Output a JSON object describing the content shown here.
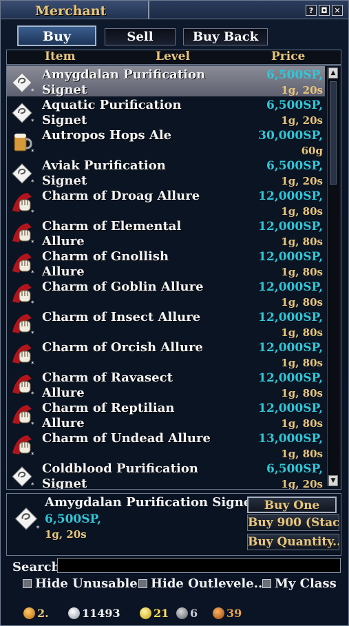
{
  "window": {
    "title": "Merchant"
  },
  "title_buttons": [
    "?",
    "◘",
    "✕"
  ],
  "tabs": [
    {
      "label": "Buy",
      "active": true
    },
    {
      "label": "Sell",
      "active": false
    },
    {
      "label": "Buy Back",
      "active": false
    }
  ],
  "columns": {
    "item": "Item",
    "level": "Level",
    "price": "Price"
  },
  "items": [
    {
      "name": "Amygdalan Purification Signet",
      "price": "6,500SP,",
      "sub": "1g, 20s",
      "icon": "signet-icon",
      "selected": true
    },
    {
      "name": "Aquatic Purification Signet",
      "price": "6,500SP,",
      "sub": "1g, 20s",
      "icon": "signet-icon"
    },
    {
      "name": "Autropos Hops Ale",
      "price": "30,000SP,",
      "sub": "60g",
      "icon": "ale-mug-icon"
    },
    {
      "name": "Aviak Purification Signet",
      "price": "6,500SP,",
      "sub": "1g, 20s",
      "icon": "signet-icon"
    },
    {
      "name": "Charm of Droag Allure",
      "price": "12,000SP,",
      "sub": "1g, 80s",
      "icon": "charm-fist-icon"
    },
    {
      "name": "Charm of Elemental Allure",
      "price": "12,000SP,",
      "sub": "1g, 80s",
      "icon": "charm-fist-icon"
    },
    {
      "name": "Charm of Gnollish Allure",
      "price": "12,000SP,",
      "sub": "1g, 80s",
      "icon": "charm-fist-icon"
    },
    {
      "name": "Charm of Goblin Allure",
      "price": "12,000SP,",
      "sub": "1g, 80s",
      "icon": "charm-fist-icon"
    },
    {
      "name": "Charm of Insect Allure",
      "price": "12,000SP,",
      "sub": "1g, 80s",
      "icon": "charm-fist-icon"
    },
    {
      "name": "Charm of Orcish Allure",
      "price": "12,000SP,",
      "sub": "1g, 80s",
      "icon": "charm-fist-icon"
    },
    {
      "name": "Charm of Ravasect Allure",
      "price": "12,000SP,",
      "sub": "1g, 80s",
      "icon": "charm-fist-icon"
    },
    {
      "name": "Charm of Reptilian Allure",
      "price": "12,000SP,",
      "sub": "1g, 80s",
      "icon": "charm-fist-icon"
    },
    {
      "name": "Charm of Undead Allure",
      "price": "13,000SP,",
      "sub": "1g, 80s",
      "icon": "charm-fist-icon"
    },
    {
      "name": "Coldblood Purification Signet",
      "price": "6,500SP,",
      "sub": "1g, 20s",
      "icon": "signet-icon"
    }
  ],
  "detail": {
    "name": "Amygdalan Purification Signet",
    "price": "6,500SP,",
    "sub": "1g, 20s",
    "buy_one": "Buy One",
    "buy_stack": "Buy 900 (Stac...",
    "buy_quantity": "Buy Quantity..."
  },
  "search": {
    "label": "Search",
    "value": ""
  },
  "filters": [
    {
      "label": "Hide Unusable",
      "checked": false
    },
    {
      "label": "Hide Outlevele..",
      "checked": false
    },
    {
      "label": "My Class",
      "checked": false
    }
  ],
  "currency": [
    {
      "icon": "orange-token-icon",
      "value": "2.",
      "color": "#e9c67a"
    },
    {
      "icon": "silver-coin-icon",
      "value": "11493",
      "color": "#f0f0f0"
    },
    {
      "icon": "gold-coin-icon",
      "value": "21",
      "color": "#ffe15a"
    },
    {
      "icon": "gray-token-icon",
      "value": "6",
      "color": "#c8ccd4"
    },
    {
      "icon": "bronze-token-icon",
      "value": "39",
      "color": "#e9a24a"
    }
  ]
}
